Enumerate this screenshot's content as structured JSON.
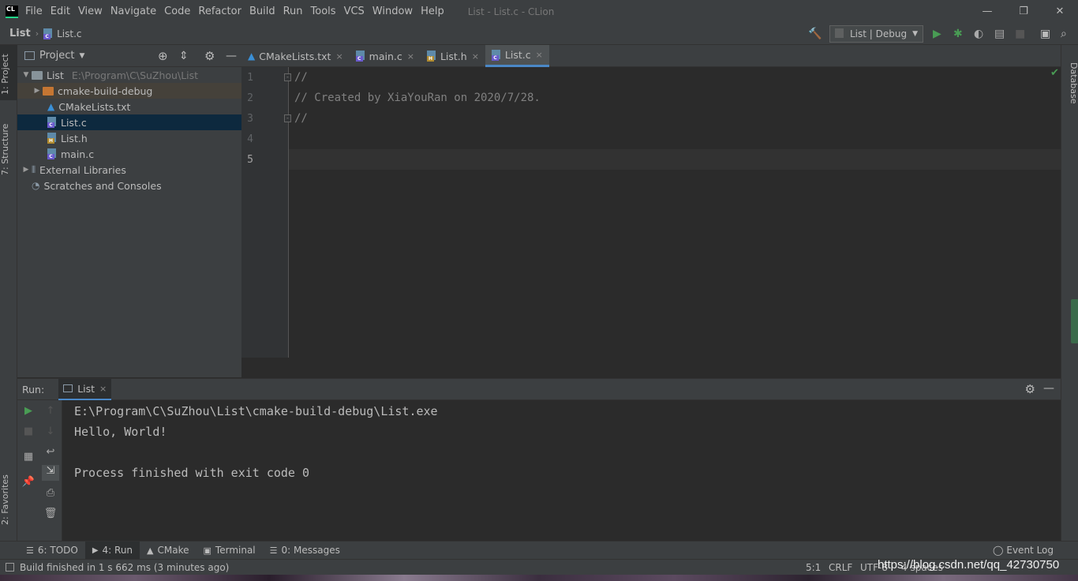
{
  "app": {
    "logo": "CL",
    "window_title": "List - List.c - CLion"
  },
  "menu": [
    "File",
    "Edit",
    "View",
    "Navigate",
    "Code",
    "Refactor",
    "Build",
    "Run",
    "Tools",
    "VCS",
    "Window",
    "Help"
  ],
  "window_controls": {
    "minimize": "—",
    "restore": "❐",
    "close": "✕"
  },
  "navbar": {
    "project": "List",
    "file": "List.c",
    "run_config": "List | Debug"
  },
  "left_strip": {
    "project_tab": "1: Project",
    "structure_tab": "7: Structure",
    "favorites_tab": "2: Favorites"
  },
  "right_strip": {
    "database_tab": "Database"
  },
  "project_panel": {
    "title": "Project",
    "root": {
      "name": "List",
      "path": "E:\\Program\\C\\SuZhou\\List"
    },
    "items": [
      {
        "name": "cmake-build-debug",
        "type": "folder"
      },
      {
        "name": "CMakeLists.txt",
        "type": "cmake"
      },
      {
        "name": "List.c",
        "type": "c"
      },
      {
        "name": "List.h",
        "type": "h"
      },
      {
        "name": "main.c",
        "type": "c"
      }
    ],
    "external_libraries": "External Libraries",
    "scratches": "Scratches and Consoles"
  },
  "editor_tabs": [
    {
      "label": "CMakeLists.txt",
      "close": "×"
    },
    {
      "label": "main.c",
      "close": "×"
    },
    {
      "label": "List.h",
      "close": "×"
    },
    {
      "label": "List.c",
      "close": "×"
    }
  ],
  "editor": {
    "line_numbers": [
      "1",
      "2",
      "3",
      "4",
      "5"
    ],
    "lines": [
      "//",
      "// Created by XiaYouRan on 2020/7/28.",
      "//",
      "",
      ""
    ]
  },
  "run_panel": {
    "label": "Run:",
    "tab": "List",
    "tab_close": "×",
    "console": [
      "E:\\Program\\C\\SuZhou\\List\\cmake-build-debug\\List.exe",
      "Hello, World!",
      "",
      "Process finished with exit code 0"
    ]
  },
  "bottom_tabs": [
    {
      "label": "6: TODO",
      "icon": "todo-icon"
    },
    {
      "label": "4: Run",
      "icon": "run-icon"
    },
    {
      "label": "CMake",
      "icon": "cmake-icon"
    },
    {
      "label": "Terminal",
      "icon": "terminal-icon"
    },
    {
      "label": "0: Messages",
      "icon": "messages-icon"
    }
  ],
  "event_log": "Event Log",
  "status": {
    "message": "Build finished in 1 s 662 ms (3 minutes ago)",
    "position": "5:1",
    "line_sep": "CRLF",
    "encoding": "UTF-8",
    "indent": "4 spaces"
  },
  "watermark": "https://blog.csdn.net/qq_42730750",
  "colors": {
    "accent": "#4a88c7",
    "run_green": "#499c54",
    "selection": "#0d293e",
    "folder_orange": "#c57633"
  }
}
